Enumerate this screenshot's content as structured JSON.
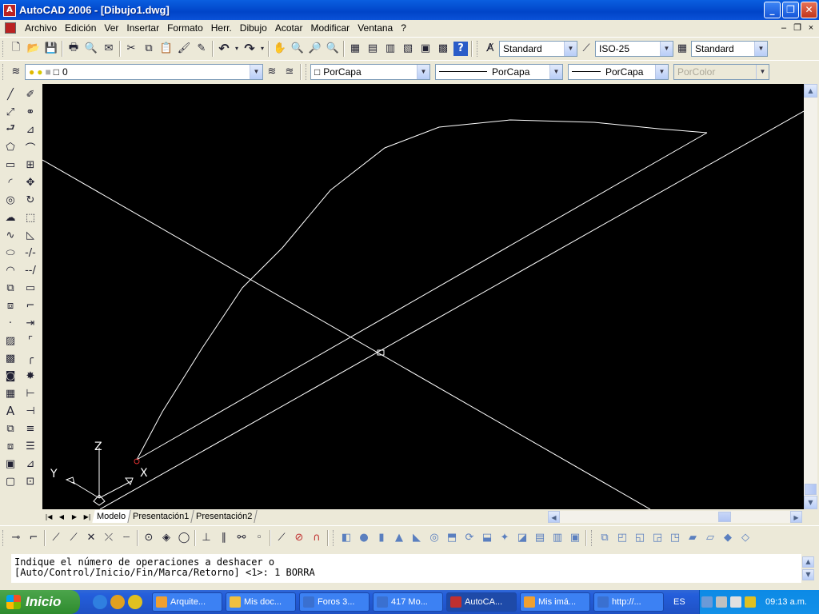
{
  "window": {
    "title": "AutoCAD 2006 - [Dibujo1.dwg]",
    "buttons": {
      "minimize": "_",
      "restore": "❐",
      "close": "✕"
    }
  },
  "menu": {
    "items": [
      "Archivo",
      "Edición",
      "Ver",
      "Insertar",
      "Formato",
      "Herr.",
      "Dibujo",
      "Acotar",
      "Modificar",
      "Ventana",
      "?"
    ],
    "controls": {
      "minimize": "–",
      "restore": "❐",
      "close": "×"
    }
  },
  "toolbar": {
    "text_style": "Standard",
    "dim_style": "ISO-25",
    "table_style": "Standard",
    "layer": "0",
    "color": "PorCapa",
    "linetype": "PorCapa",
    "lineweight": "PorCapa",
    "plotstyle": "PorColor"
  },
  "ucs": {
    "x": "X",
    "y": "Y",
    "z": "Z"
  },
  "layout_tabs": [
    "Modelo",
    "Presentación1",
    "Presentación2"
  ],
  "command": {
    "line1": "Indique el número de operaciones a deshacer o",
    "line2": "[Auto/Control/Inicio/Fin/Marca/Retorno] <1>: 1 BORRA"
  },
  "taskbar": {
    "start": "Inicio",
    "tasks": [
      "Arquite...",
      "Mis doc...",
      "Foros 3...",
      "417 Mo...",
      "AutoCA...",
      "Mis imá...",
      "http://..."
    ],
    "language": "ES",
    "clock": "09:13 a.m."
  },
  "colors": {
    "canvas": "#000000",
    "lines": "#ffffff",
    "title_bar": "#0a5fe0",
    "taskbar": "#245edb",
    "start": "#3c9a3c"
  }
}
